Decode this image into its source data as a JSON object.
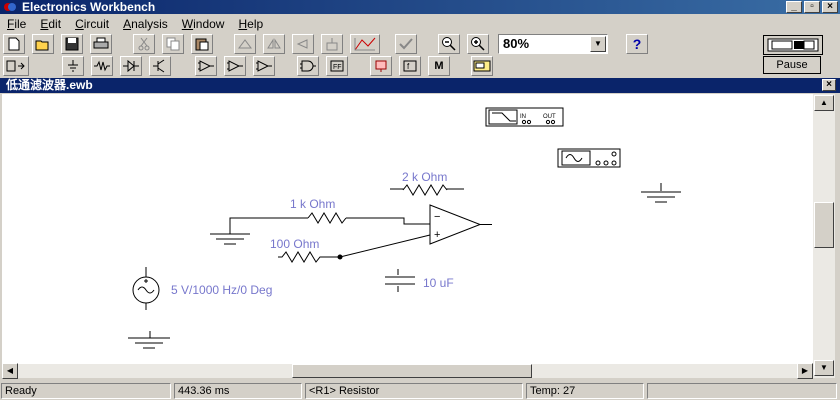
{
  "window": {
    "title": "Electronics Workbench"
  },
  "menubar": {
    "items": [
      {
        "u": "F",
        "rest": "ile"
      },
      {
        "u": "E",
        "rest": "dit"
      },
      {
        "u": "C",
        "rest": "ircuit"
      },
      {
        "u": "A",
        "rest": "nalysis"
      },
      {
        "u": "W",
        "rest": "indow"
      },
      {
        "u": "H",
        "rest": "elp"
      }
    ]
  },
  "toolbar": {
    "zoom": "80%",
    "help_label": "?"
  },
  "controls": {
    "pause_label": "Pause"
  },
  "document": {
    "title": "低通滤波器.ewb"
  },
  "circuit": {
    "r_top": "1 k Ohm",
    "r_feedback": "2 k Ohm",
    "r_bottom": "100  Ohm",
    "capacitor": "10 uF",
    "source": "5 V/1000 Hz/0 Deg",
    "bode_plotter": {
      "in": "IN",
      "out": "OUT"
    },
    "opamp": {
      "minus": "−",
      "plus": "+"
    }
  },
  "status": {
    "ready": "Ready",
    "time": "443.36 ms",
    "selected": "<R1> Resistor",
    "temp": "Temp:  27"
  },
  "colors": {
    "label": "#7777cc",
    "titlebar": "#0a246a",
    "canvas": "#ffffff"
  }
}
